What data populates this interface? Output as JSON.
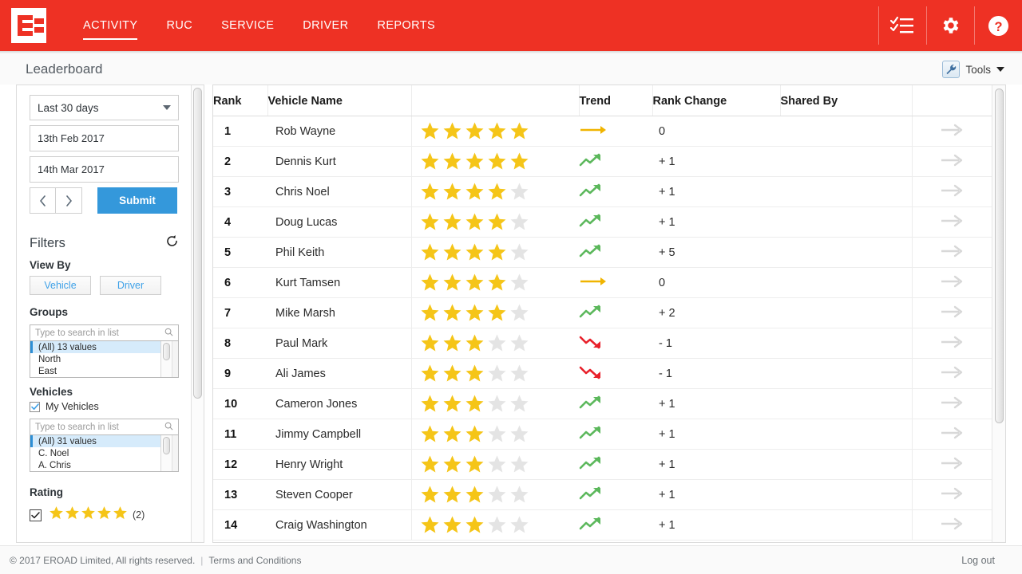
{
  "topnav": {
    "logo_name": "eroad-logo",
    "links": [
      {
        "label": "ACTIVITY",
        "active": true
      },
      {
        "label": "RUC",
        "active": false
      },
      {
        "label": "SERVICE",
        "active": false
      },
      {
        "label": "DRIVER",
        "active": false
      },
      {
        "label": "REPORTS",
        "active": false
      }
    ],
    "icons": [
      "checklist-icon",
      "gear-icon",
      "help-icon"
    ],
    "background_color": "#ee3124"
  },
  "pagehead": {
    "title": "Leaderboard",
    "tools_label": "Tools"
  },
  "sidebar": {
    "date_range": "Last 30 days",
    "date_from": "13th Feb 2017",
    "date_to": "14th Mar 2017",
    "prev_label": "‹",
    "next_label": "›",
    "submit_label": "Submit",
    "filters_title": "Filters",
    "view_by_label": "View By",
    "view_by_options": [
      "Vehicle",
      "Driver"
    ],
    "groups_label": "Groups",
    "groups_search_placeholder": "Type to search in list",
    "groups_items": [
      "(All) 13 values",
      "North",
      "East"
    ],
    "vehicles_label": "Vehicles",
    "my_vehicles_label": "My Vehicles",
    "vehicles_search_placeholder": "Type to search in list",
    "vehicles_items": [
      "(All) 31 values",
      "C. Noel",
      "A. Chris"
    ],
    "rating_label": "Rating",
    "rating_stars": 5,
    "rating_count": "(2)"
  },
  "table": {
    "columns": [
      "Rank",
      "Vehicle Name",
      "",
      "Trend",
      "Rank Change",
      "Shared By",
      ""
    ],
    "rows": [
      {
        "rank": "1",
        "name": "Rob Wayne",
        "stars": 5,
        "trend": "flat",
        "change": "0",
        "shared": ""
      },
      {
        "rank": "2",
        "name": "Dennis Kurt",
        "stars": 5,
        "trend": "up",
        "change": "+ 1",
        "shared": ""
      },
      {
        "rank": "3",
        "name": "Chris Noel",
        "stars": 4,
        "trend": "up",
        "change": "+ 1",
        "shared": ""
      },
      {
        "rank": "4",
        "name": "Doug Lucas",
        "stars": 4,
        "trend": "up",
        "change": "+ 1",
        "shared": ""
      },
      {
        "rank": "5",
        "name": "Phil Keith",
        "stars": 4,
        "trend": "up",
        "change": "+ 5",
        "shared": ""
      },
      {
        "rank": "6",
        "name": "Kurt Tamsen",
        "stars": 4,
        "trend": "flat",
        "change": "0",
        "shared": ""
      },
      {
        "rank": "7",
        "name": "Mike Marsh",
        "stars": 4,
        "trend": "up",
        "change": "+ 2",
        "shared": ""
      },
      {
        "rank": "8",
        "name": "Paul Mark",
        "stars": 3,
        "trend": "down",
        "change": "- 1",
        "shared": ""
      },
      {
        "rank": "9",
        "name": "Ali James",
        "stars": 3,
        "trend": "down",
        "change": "- 1",
        "shared": ""
      },
      {
        "rank": "10",
        "name": "Cameron Jones",
        "stars": 3,
        "trend": "up",
        "change": "+ 1",
        "shared": ""
      },
      {
        "rank": "11",
        "name": "Jimmy Campbell",
        "stars": 3,
        "trend": "up",
        "change": "+ 1",
        "shared": ""
      },
      {
        "rank": "12",
        "name": "Henry Wright",
        "stars": 3,
        "trend": "up",
        "change": "+ 1",
        "shared": ""
      },
      {
        "rank": "13",
        "name": "Steven Cooper",
        "stars": 3,
        "trend": "up",
        "change": "+ 1",
        "shared": ""
      },
      {
        "rank": "14",
        "name": "Craig Washington",
        "stars": 3,
        "trend": "up",
        "change": "+ 1",
        "shared": ""
      }
    ],
    "max_stars": 5
  },
  "footer": {
    "copyright": "© 2017 EROAD Limited, All rights reserved.",
    "separator": "|",
    "terms": "Terms and Conditions",
    "logout": "Log out"
  },
  "colors": {
    "brand_red": "#ee3124",
    "star_gold": "#f5c518",
    "star_grey": "#e4e4e4",
    "trend_up": "#5cb85c",
    "trend_flat": "#f0b400",
    "trend_down": "#e8202a",
    "submit_blue": "#3498db"
  }
}
